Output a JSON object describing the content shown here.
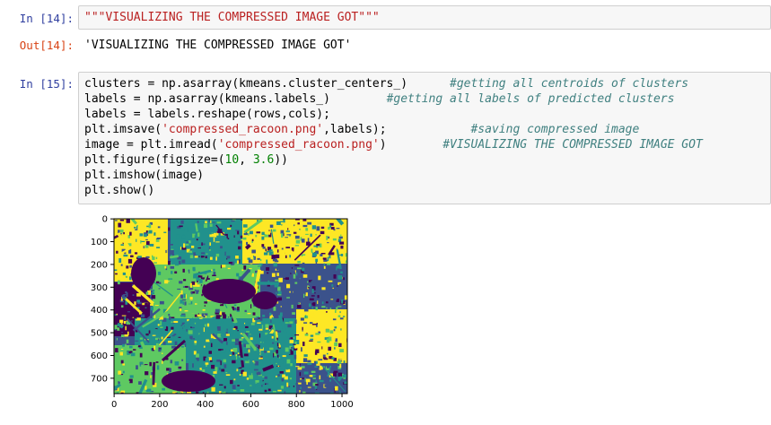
{
  "cells": {
    "c14": {
      "in_prompt": "In [14]:",
      "code": "\"\"\"VISUALIZING THE COMPRESSED IMAGE GOT\"\"\"",
      "out_prompt": "Out[14]:",
      "output": "'VISUALIZING THE COMPRESSED IMAGE GOT'"
    },
    "c15": {
      "in_prompt": "In [15]:",
      "lines": [
        {
          "code": "clusters = np.asarray(kmeans.cluster_centers_)",
          "pad": "      ",
          "comment": "#getting all centroids of clusters"
        },
        {
          "code": "labels = np.asarray(kmeans.labels_)",
          "pad": "        ",
          "comment": "#getting all labels of predicted clusters"
        },
        {
          "code": "labels = labels.reshape(rows,cols);"
        },
        {
          "pre": "plt.imsave(",
          "str": "'compressed_racoon.png'",
          "post": ",labels);",
          "pad": "            ",
          "comment": "#saving compressed image"
        },
        {
          "pre": "image = plt.imread(",
          "str": "'compressed_racoon.png'",
          "post": ")",
          "pad": "        ",
          "comment": "#VISUALIZING THE COMPRESSED IMAGE GOT"
        },
        {
          "pre": "plt.figure(figsize=(",
          "num1": "10",
          "mid": ", ",
          "num2": "3.6",
          "post": "))"
        },
        {
          "code": "plt.imshow(image)"
        },
        {
          "code": "plt.show()"
        }
      ]
    }
  },
  "plot": {
    "y_ticks": [
      "0",
      "100",
      "200",
      "300",
      "400",
      "500",
      "600",
      "700"
    ],
    "x_ticks": [
      "0",
      "200",
      "400",
      "600",
      "800",
      "1000"
    ],
    "colors": {
      "purple": "#440154",
      "blue": "#3b528b",
      "teal": "#21918c",
      "green": "#5ec962",
      "yellow": "#fde725"
    }
  }
}
